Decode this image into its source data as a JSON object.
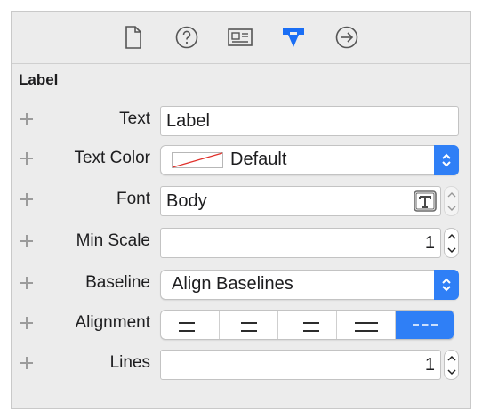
{
  "toolbar": {
    "tabs": [
      {
        "icon": "file-icon",
        "active": false
      },
      {
        "icon": "help-icon",
        "active": false
      },
      {
        "icon": "identity-icon",
        "active": false
      },
      {
        "icon": "attributes-icon",
        "active": true
      },
      {
        "icon": "connections-icon",
        "active": false
      }
    ],
    "active_color": "#1a6ef5"
  },
  "section": {
    "title": "Label"
  },
  "fields": {
    "text": {
      "label": "Text",
      "value": "Label"
    },
    "text_color": {
      "label": "Text Color",
      "value": "Default"
    },
    "font": {
      "label": "Font",
      "value": "Body"
    },
    "min_scale": {
      "label": "Min Scale",
      "value": "1"
    },
    "baseline": {
      "label": "Baseline",
      "value": "Align Baselines"
    },
    "alignment": {
      "label": "Alignment",
      "options": [
        "left",
        "center",
        "right",
        "justified",
        "natural"
      ],
      "selected": "natural"
    },
    "lines": {
      "label": "Lines",
      "value": "1"
    }
  }
}
